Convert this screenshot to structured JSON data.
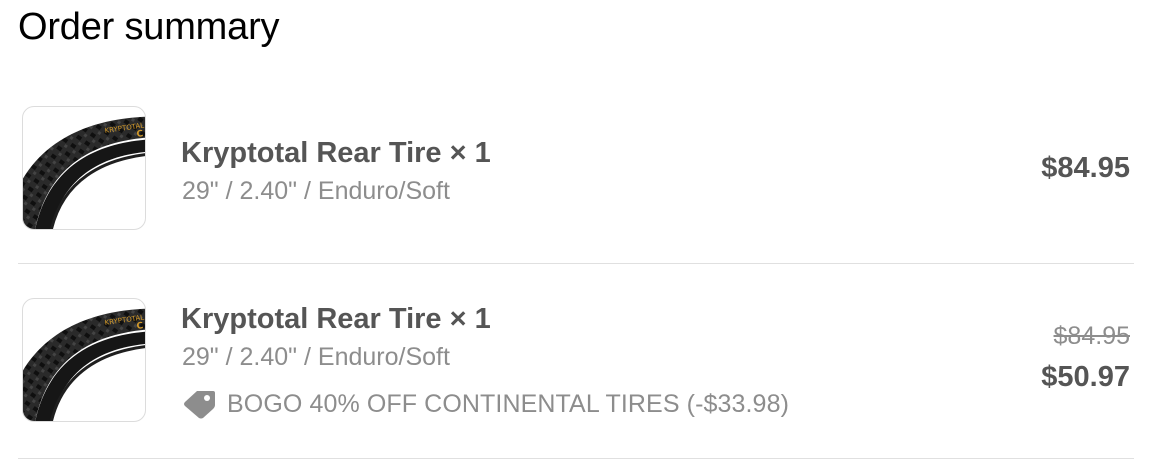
{
  "heading": "Order summary",
  "items": [
    {
      "title": "Kryptotal Rear Tire × 1",
      "variant": "29\" / 2.40\" / Enduro/Soft",
      "price": "$84.95",
      "thumbnail_icon": "tire-icon"
    },
    {
      "title": "Kryptotal Rear Tire × 1",
      "variant": "29\" / 2.40\" / Enduro/Soft",
      "original_price": "$84.95",
      "price": "$50.97",
      "discount": "BOGO 40% OFF CONTINENTAL TIRES (-$33.98)",
      "discount_icon": "tag-icon",
      "thumbnail_icon": "tire-icon"
    }
  ],
  "colors": {
    "title": "#555555",
    "muted": "#8d8d8d",
    "divider": "#e0e0e0",
    "tire_label": "#d39a2a"
  }
}
